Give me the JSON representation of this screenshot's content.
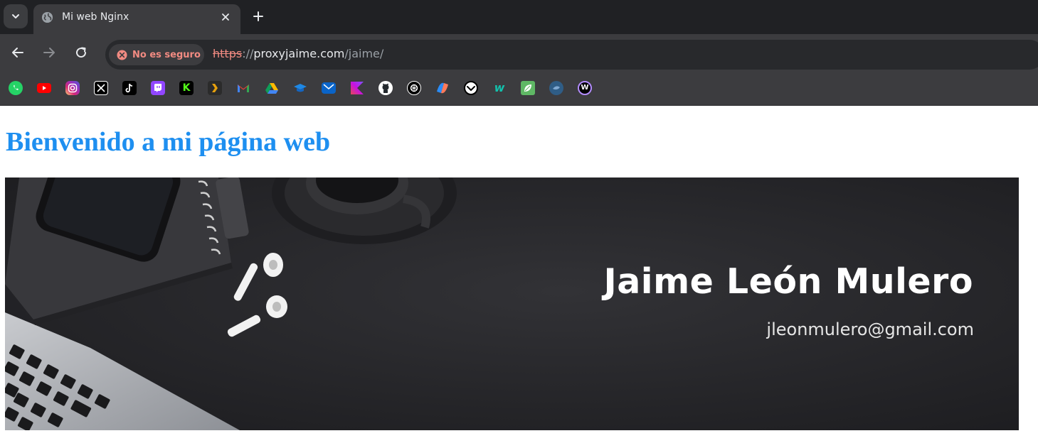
{
  "browser": {
    "tab": {
      "title": "Mi web Nginx",
      "favicon": "globe-icon"
    },
    "toolbar": {
      "back": "arrow-left-icon",
      "forward": "arrow-right-icon",
      "reload": "reload-icon"
    },
    "address_bar": {
      "security_label": "No es seguro",
      "scheme": "https",
      "separator": "://",
      "host": "proxyjaime.com",
      "path": "/jaime/"
    },
    "bookmarks": [
      {
        "name": "whatsapp-icon",
        "color": "#25d366"
      },
      {
        "name": "youtube-icon",
        "color": "#ff0000"
      },
      {
        "name": "instagram-icon",
        "color": "#e1306c"
      },
      {
        "name": "x-icon",
        "color": "#000000"
      },
      {
        "name": "tiktok-icon",
        "color": "#000000"
      },
      {
        "name": "twitch-icon",
        "color": "#9146ff"
      },
      {
        "name": "kick-icon",
        "color": "#53fc18"
      },
      {
        "name": "plex-icon",
        "color": "#e5a00d"
      },
      {
        "name": "gmail-icon",
        "color": "#ea4335"
      },
      {
        "name": "google-drive-icon",
        "color": "#1fa463"
      },
      {
        "name": "classroom-icon",
        "color": "#1e88e5"
      },
      {
        "name": "outlook-mail-icon",
        "color": "#0a64c8"
      },
      {
        "name": "kotlin-icon",
        "color": "#7f52ff"
      },
      {
        "name": "github-icon",
        "color": "#ffffff"
      },
      {
        "name": "chatgpt-icon",
        "color": "#ffffff"
      },
      {
        "name": "copilot-icon",
        "color": "#6b8cff"
      },
      {
        "name": "check-circle-icon",
        "color": "#000000"
      },
      {
        "name": "wallapop-icon",
        "color": "#13c1ac"
      },
      {
        "name": "leaf-app-icon",
        "color": "#5fb865"
      },
      {
        "name": "globe-app-icon",
        "color": "#2f5d86"
      },
      {
        "name": "w-app-icon",
        "color": "#8e2de2"
      }
    ]
  },
  "page": {
    "heading": "Bienvenido a mi página web",
    "heading_color": "#1e8ff0",
    "banner": {
      "name": "Jaime León Mulero",
      "email": "jleonmulero@gmail.com"
    }
  }
}
